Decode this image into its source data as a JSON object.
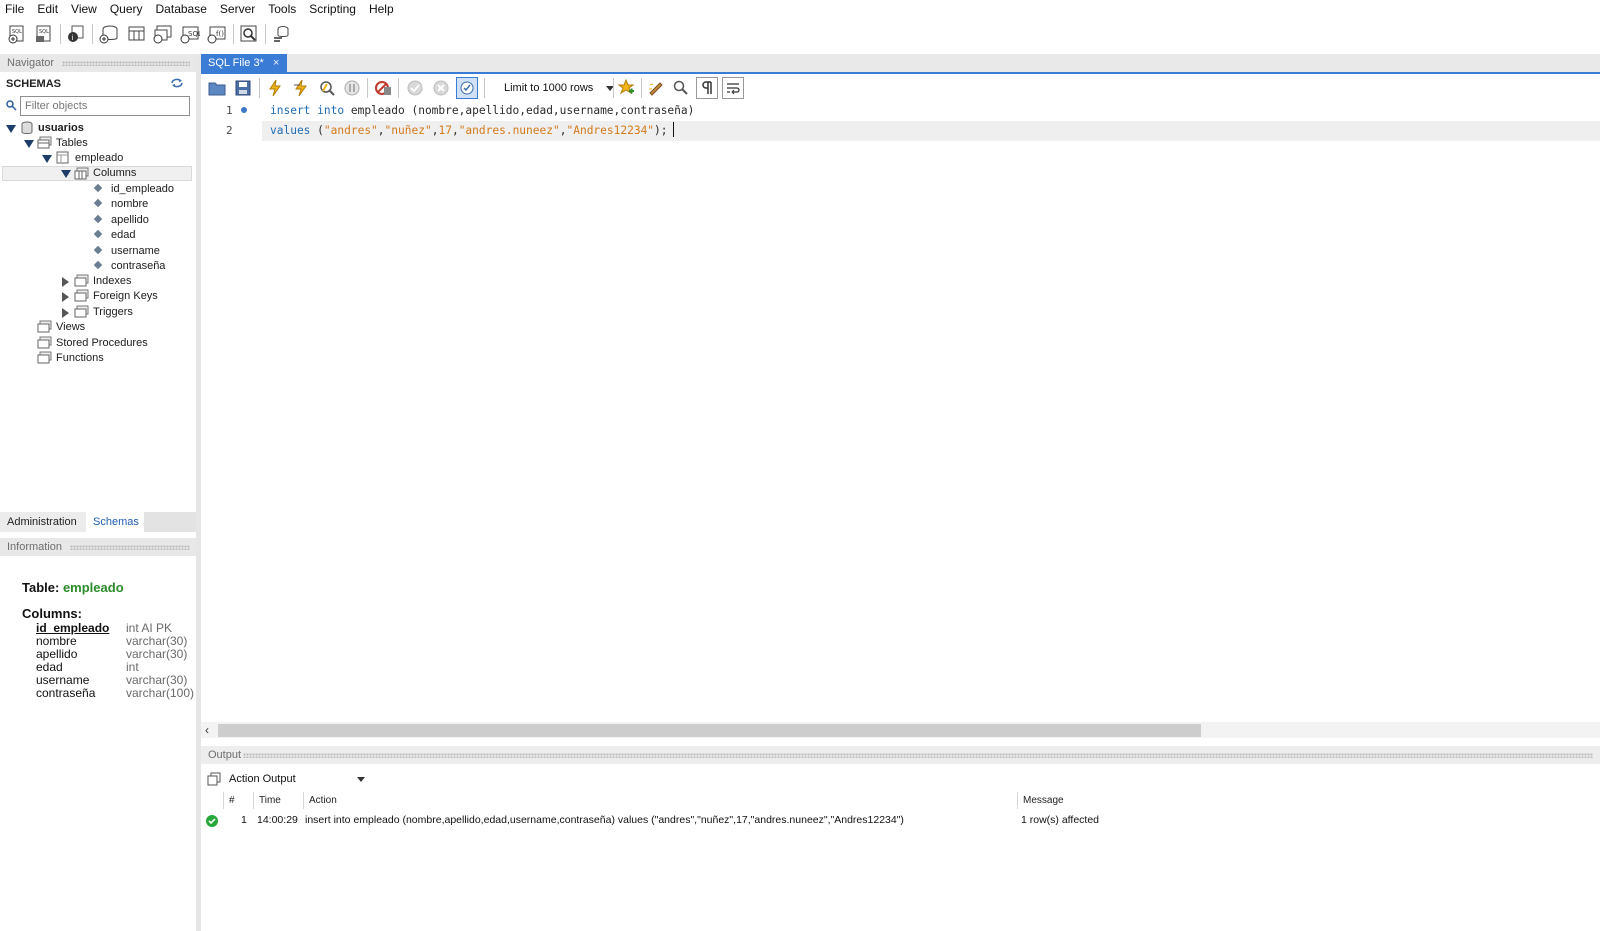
{
  "menu": [
    "File",
    "Edit",
    "View",
    "Query",
    "Database",
    "Server",
    "Tools",
    "Scripting",
    "Help"
  ],
  "navigator": {
    "header": "Navigator",
    "schemas_title": "SCHEMAS",
    "filter_placeholder": "Filter objects",
    "tree": {
      "schema": "usuarios",
      "tables": "Tables",
      "table": "empleado",
      "columns_folder": "Columns",
      "columns": [
        "id_empleado",
        "nombre",
        "apellido",
        "edad",
        "username",
        "contraseña"
      ],
      "indexes": "Indexes",
      "foreign_keys": "Foreign Keys",
      "triggers": "Triggers",
      "views": "Views",
      "stored_procedures": "Stored Procedures",
      "functions": "Functions"
    },
    "tabs": [
      "Administration",
      "Schemas"
    ]
  },
  "information": {
    "header": "Information",
    "table_label": "Table:",
    "table_name": "empleado",
    "columns_label": "Columns:",
    "columns": [
      {
        "name": "id_empleado",
        "type": "int AI PK"
      },
      {
        "name": "nombre",
        "type": "varchar(30)"
      },
      {
        "name": "apellido",
        "type": "varchar(30)"
      },
      {
        "name": "edad",
        "type": "int"
      },
      {
        "name": "username",
        "type": "varchar(30)"
      },
      {
        "name": "contraseña",
        "type": "varchar(100)"
      }
    ]
  },
  "editor": {
    "tab_title": "SQL File 3*",
    "tab_close": "×",
    "limit_rows": "Limit to 1000 rows",
    "line_numbers": [
      "1",
      "2"
    ],
    "line1": {
      "kw1": "insert",
      "kw2": "into",
      "rest": " empleado (nombre,apellido,edad,username,contraseña)"
    },
    "line2": {
      "kw": "values",
      "open": " (",
      "s1": "\"andres\"",
      "s2": "\"nuñez\"",
      "n": "17",
      "s3": "\"andres.nuneez\"",
      "s4": "\"Andres12234\"",
      "close": ");",
      "comma": ","
    }
  },
  "output": {
    "header": "Output",
    "mode": "Action Output",
    "columns": [
      "#",
      "Time",
      "Action",
      "Message"
    ],
    "rows": [
      {
        "num": "1",
        "time": "14:00:29",
        "action": "insert into empleado (nombre,apellido,edad,username,contraseña) values (\"andres\",\"nuñez\",17,\"andres.nuneez\",\"Andres12234\")",
        "message": "1 row(s) affected",
        "status": "success"
      }
    ]
  },
  "colors": {
    "accent": "#3a7bd5",
    "keyword": "#1f6cb5",
    "string": "#d47a1a",
    "table_name": "#2a8c2a",
    "success": "#27a83a"
  }
}
